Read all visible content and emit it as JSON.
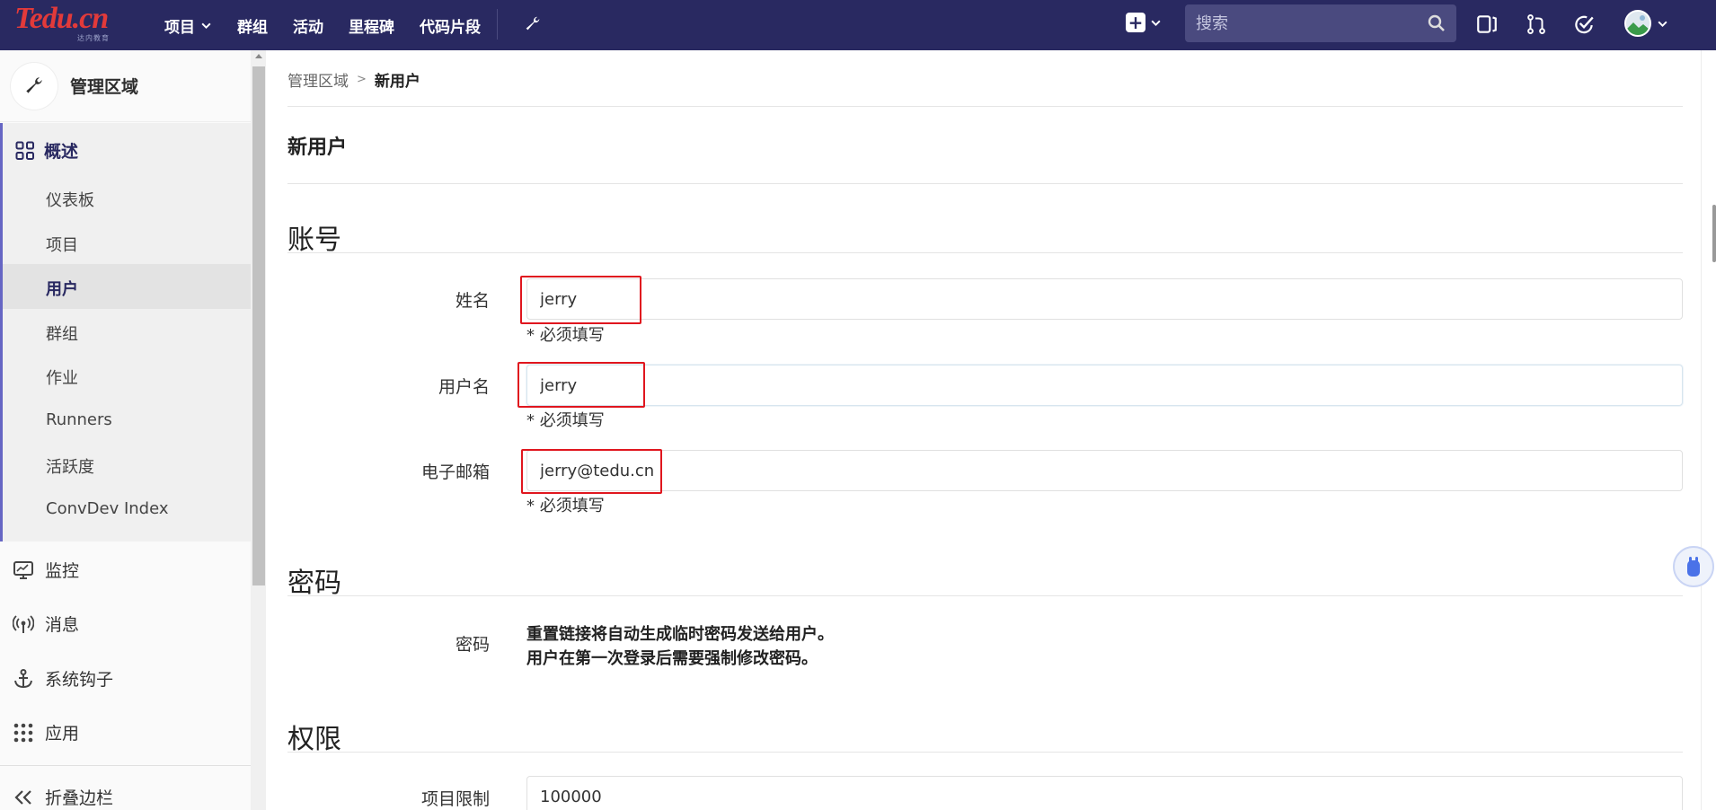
{
  "navbar": {
    "logo_text": "Tedu.cn",
    "logo_sub": "达内教育",
    "links": [
      "项目",
      "群组",
      "活动",
      "里程碑",
      "代码片段"
    ],
    "search_placeholder": "搜索"
  },
  "sidebar": {
    "header_title": "管理区域",
    "section_title": "概述",
    "sub_items": [
      "仪表板",
      "项目",
      "用户",
      "群组",
      "作业",
      "Runners",
      "活跃度",
      "ConvDev Index"
    ],
    "active_sub": "用户",
    "items": [
      "监控",
      "消息",
      "系统钩子",
      "应用"
    ],
    "collapse_label": "折叠边栏"
  },
  "breadcrumb": {
    "parent": "管理区域",
    "current": "新用户"
  },
  "page_title": "新用户",
  "account": {
    "section_title": "账号",
    "name_label": "姓名",
    "name_value": "jerry",
    "username_label": "用户名",
    "username_value": "jerry",
    "email_label": "电子邮箱",
    "email_value": "jerry@tedu.cn",
    "required_hint": "* 必须填写"
  },
  "password": {
    "section_title": "密码",
    "label": "密码",
    "note_line1": "重置链接将自动生成临时密码发送给用户。",
    "note_line2": "用户在第一次登录后需要强制修改密码。"
  },
  "permissions": {
    "section_title": "权限",
    "project_limit_label": "项目限制",
    "project_limit_value": "100000"
  },
  "colors": {
    "navbar_bg": "#292961",
    "accent": "#6666c4",
    "highlight_box": "#e0161e"
  }
}
